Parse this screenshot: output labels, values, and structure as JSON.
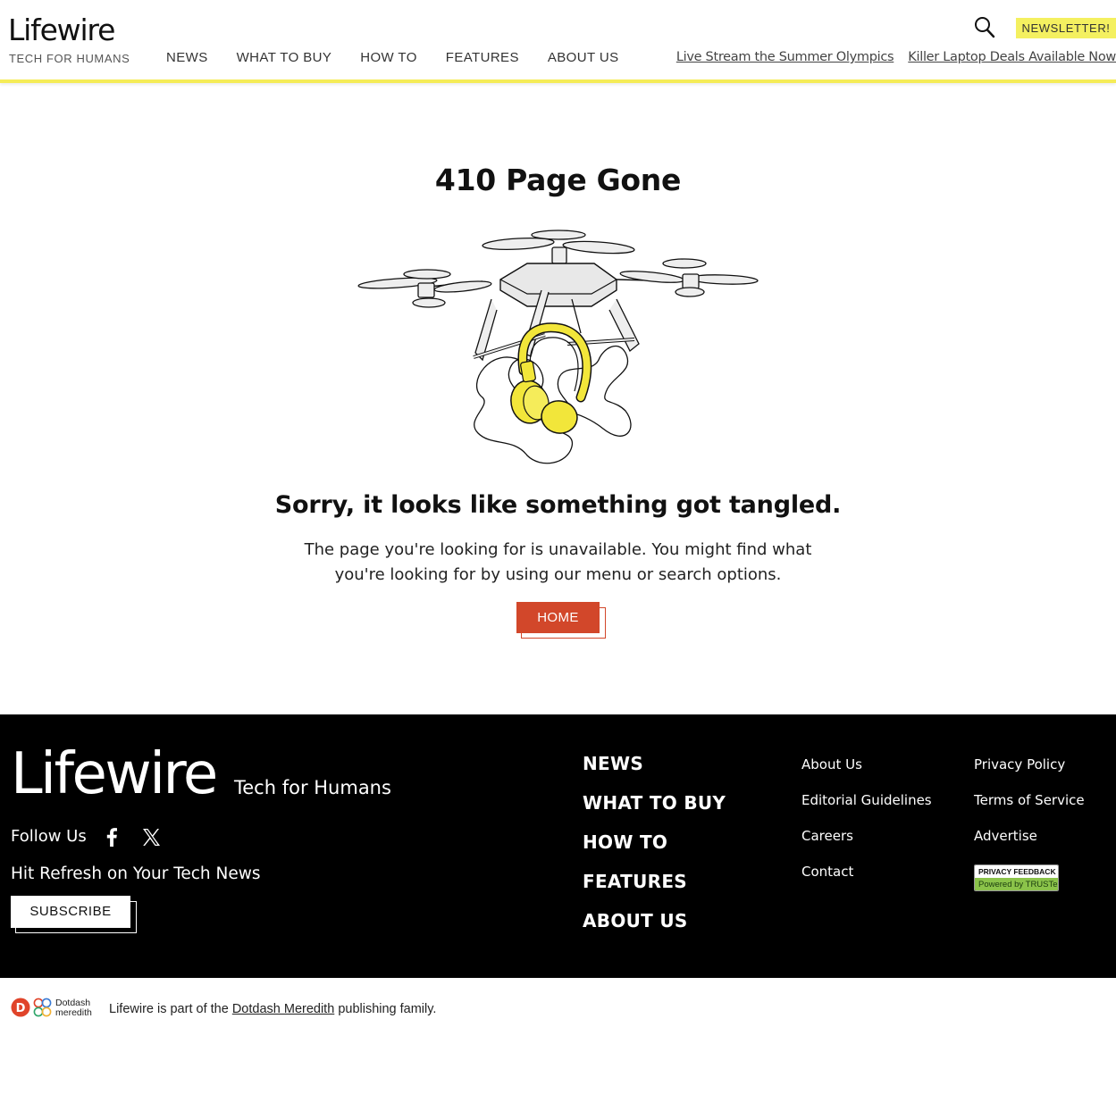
{
  "header": {
    "logo": "Lifewire",
    "tagline": "TECH FOR HUMANS",
    "nav": [
      "NEWS",
      "WHAT TO BUY",
      "HOW TO",
      "FEATURES",
      "ABOUT US"
    ],
    "search_icon": "search-icon",
    "newsletter_label": "NEWSLETTER!",
    "trending": [
      "Live Stream the Summer Olympics",
      "Killer Laptop Deals Available Now"
    ]
  },
  "main": {
    "title": "410 Page Gone",
    "illustration": "drone-headphones-illustration",
    "headline": "Sorry, it looks like something got tangled.",
    "body": "The page you're looking for is unavailable. You might find what you're looking for by using our menu or search options.",
    "home_label": "HOME"
  },
  "footer": {
    "logo": "Lifewire",
    "tagline": "Tech for Humans",
    "follow_label": "Follow Us",
    "social_icons": [
      "facebook-icon",
      "x-icon"
    ],
    "refresh_text": "Hit Refresh on Your Tech News",
    "subscribe_label": "SUBSCRIBE",
    "nav": [
      "NEWS",
      "WHAT TO BUY",
      "HOW TO",
      "FEATURES",
      "ABOUT US"
    ],
    "links_col1": [
      "About Us",
      "Editorial Guidelines",
      "Careers",
      "Contact"
    ],
    "links_col2": [
      "Privacy Policy",
      "Terms of Service",
      "Advertise"
    ],
    "truste_top": "PRIVACY FEEDBACK",
    "truste_bottom": "Powered by TRUSTe"
  },
  "bottom": {
    "dd_logo_line1": "Dotdash",
    "dd_logo_line2": "meredith",
    "text_before": "Lifewire is part of the",
    "link": "Dotdash Meredith",
    "text_after": "publishing family."
  },
  "colors": {
    "accent_yellow": "#f4f060",
    "home_button": "#d2472a",
    "footer_bg": "#000000",
    "truste_green": "#8bc34a"
  }
}
